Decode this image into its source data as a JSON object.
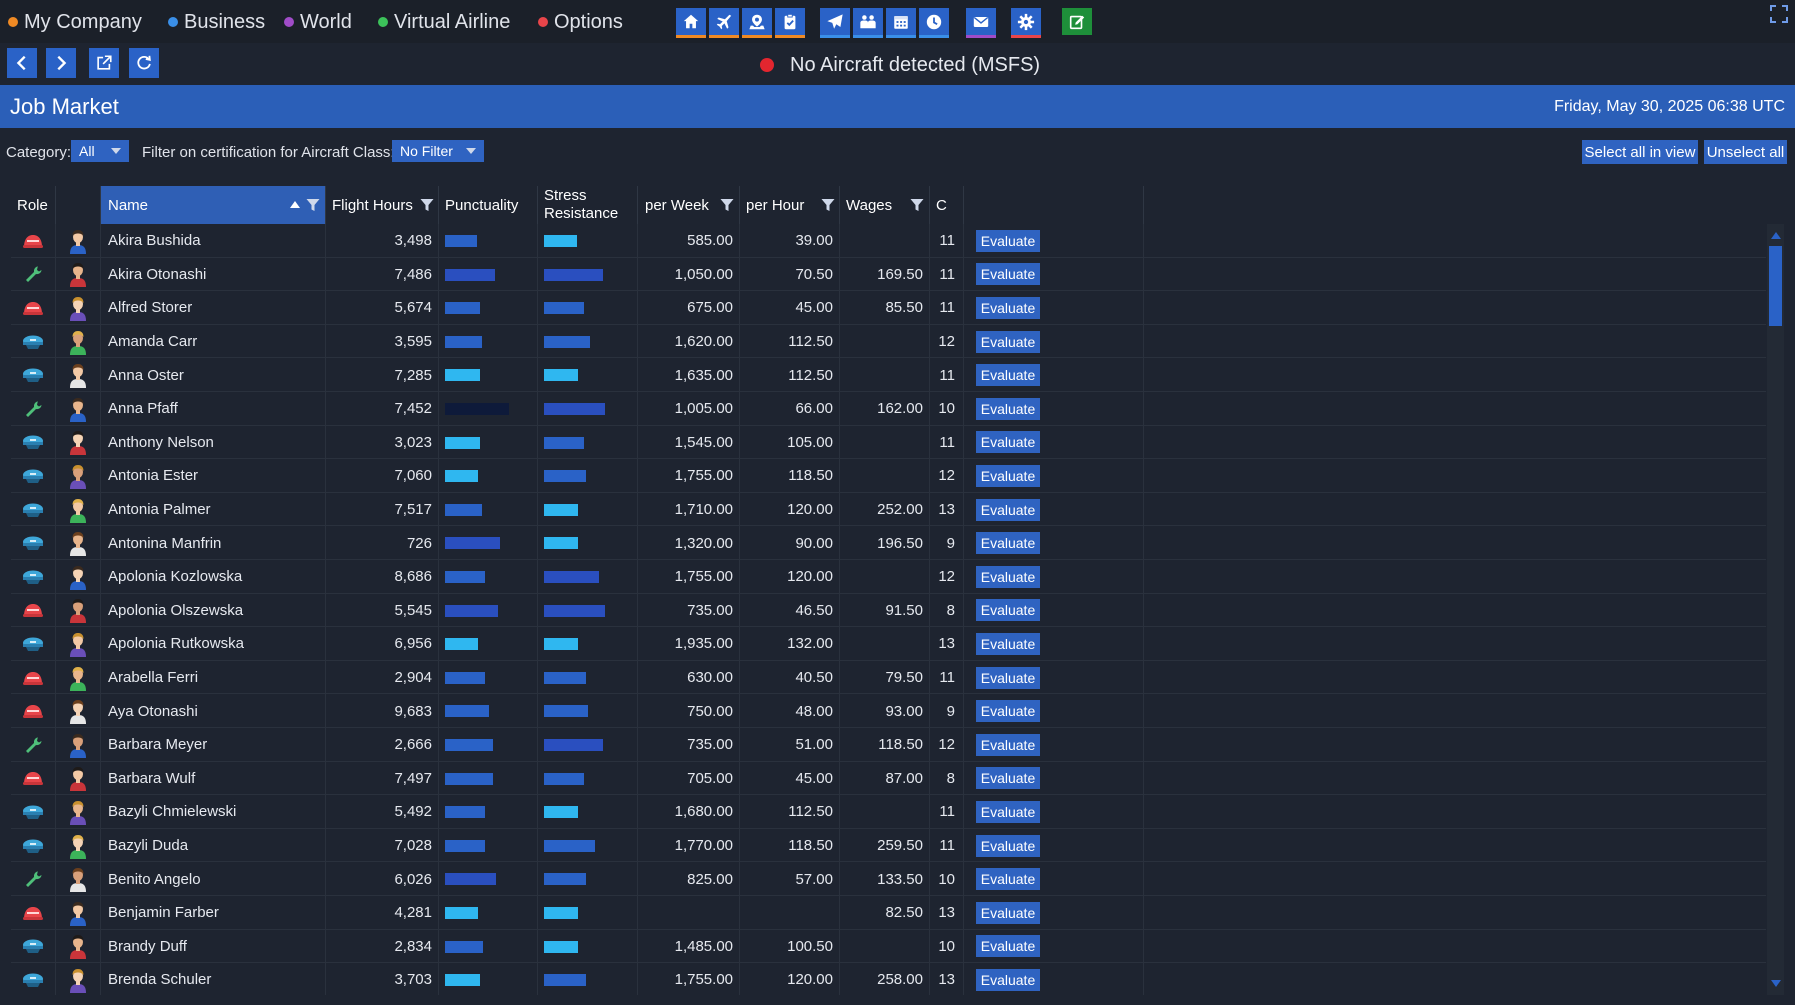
{
  "menu": {
    "items": [
      {
        "label": "My Company",
        "color": "#f08a24"
      },
      {
        "label": "Business",
        "color": "#3a8fe8"
      },
      {
        "label": "World",
        "color": "#a04cc8"
      },
      {
        "label": "Virtual Airline",
        "color": "#3cc25a"
      },
      {
        "label": "Options",
        "color": "#e8454a"
      }
    ]
  },
  "toolbar_icons": [
    "home-icon",
    "plane-icon",
    "map-pin-icon",
    "clipboard-icon",
    "paper-plane-icon",
    "people-icon",
    "calendar-icon",
    "clock-icon",
    "mail-icon",
    "gear-icon",
    "edit-icon"
  ],
  "status": {
    "text": "No Aircraft detected (MSFS)",
    "color": "#e3262f"
  },
  "page": {
    "title": "Job Market",
    "datetime": "Friday, May 30, 2025 06:38 UTC"
  },
  "filters": {
    "category_label": "Category:",
    "category_value": "All",
    "cert_label": "Filter on certification for Aircraft Class:",
    "cert_value": "No Filter",
    "select_all": "Select all in view",
    "unselect_all": "Unselect all"
  },
  "table": {
    "headers": {
      "role": "Role",
      "name": "Name",
      "flight_hours": "Flight Hours",
      "punctuality": "Punctuality",
      "stress": "Stress Resistance",
      "per_week": "per Week",
      "per_hour": "per Hour",
      "wages": "Wages",
      "c": "C"
    },
    "button_label": "Evaluate",
    "rows": [
      {
        "role": "attendant",
        "name": "Akira Bushida",
        "hours": "3,498",
        "punct": 0.35,
        "pc": "#2a62c7",
        "stress": 0.35,
        "sc": "#2fb7f0",
        "week": "585.00",
        "hour": "39.00",
        "wages": "",
        "c": "11"
      },
      {
        "role": "mechanic",
        "name": "Akira Otonashi",
        "hours": "7,486",
        "punct": 0.55,
        "pc": "#2a4fbf",
        "stress": 0.62,
        "sc": "#2a4fbf",
        "week": "1,050.00",
        "hour": "70.50",
        "wages": "169.50",
        "c": "11"
      },
      {
        "role": "attendant",
        "name": "Alfred Storer",
        "hours": "5,674",
        "punct": 0.38,
        "pc": "#2a62c7",
        "stress": 0.42,
        "sc": "#2a62c7",
        "week": "675.00",
        "hour": "45.00",
        "wages": "85.50",
        "c": "11"
      },
      {
        "role": "pilot",
        "name": "Amanda Carr",
        "hours": "3,595",
        "punct": 0.4,
        "pc": "#2a62c7",
        "stress": 0.48,
        "sc": "#2a62c7",
        "week": "1,620.00",
        "hour": "112.50",
        "wages": "",
        "c": "12"
      },
      {
        "role": "pilot",
        "name": "Anna Oster",
        "hours": "7,285",
        "punct": 0.38,
        "pc": "#2fb7f0",
        "stress": 0.36,
        "sc": "#2fb7f0",
        "week": "1,635.00",
        "hour": "112.50",
        "wages": "",
        "c": "11"
      },
      {
        "role": "mechanic",
        "name": "Anna Pfaff",
        "hours": "7,452",
        "punct": 0.7,
        "pc": "#0e1a3a",
        "stress": 0.64,
        "sc": "#2a4fbf",
        "week": "1,005.00",
        "hour": "66.00",
        "wages": "162.00",
        "c": "10"
      },
      {
        "role": "pilot",
        "name": "Anthony Nelson",
        "hours": "3,023",
        "punct": 0.38,
        "pc": "#2fb7f0",
        "stress": 0.42,
        "sc": "#2a62c7",
        "week": "1,545.00",
        "hour": "105.00",
        "wages": "",
        "c": "11"
      },
      {
        "role": "pilot",
        "name": "Antonia Ester",
        "hours": "7,060",
        "punct": 0.36,
        "pc": "#2fb7f0",
        "stress": 0.44,
        "sc": "#2a62c7",
        "week": "1,755.00",
        "hour": "118.50",
        "wages": "",
        "c": "12"
      },
      {
        "role": "pilot",
        "name": "Antonia Palmer",
        "hours": "7,517",
        "punct": 0.4,
        "pc": "#2a62c7",
        "stress": 0.36,
        "sc": "#2fb7f0",
        "week": "1,710.00",
        "hour": "120.00",
        "wages": "252.00",
        "c": "13"
      },
      {
        "role": "pilot",
        "name": "Antonina Manfrin",
        "hours": "726",
        "punct": 0.6,
        "pc": "#2a4fbf",
        "stress": 0.36,
        "sc": "#2fb7f0",
        "week": "1,320.00",
        "hour": "90.00",
        "wages": "196.50",
        "c": "9"
      },
      {
        "role": "pilot",
        "name": "Apolonia Kozlowska",
        "hours": "8,686",
        "punct": 0.44,
        "pc": "#2a62c7",
        "stress": 0.58,
        "sc": "#2a4fbf",
        "week": "1,755.00",
        "hour": "120.00",
        "wages": "",
        "c": "12"
      },
      {
        "role": "attendant",
        "name": "Apolonia Olszewska",
        "hours": "5,545",
        "punct": 0.58,
        "pc": "#2a4fbf",
        "stress": 0.64,
        "sc": "#2a4fbf",
        "week": "735.00",
        "hour": "46.50",
        "wages": "91.50",
        "c": "8"
      },
      {
        "role": "pilot",
        "name": "Apolonia Rutkowska",
        "hours": "6,956",
        "punct": 0.36,
        "pc": "#2fb7f0",
        "stress": 0.36,
        "sc": "#2fb7f0",
        "week": "1,935.00",
        "hour": "132.00",
        "wages": "",
        "c": "13"
      },
      {
        "role": "attendant",
        "name": "Arabella Ferri",
        "hours": "2,904",
        "punct": 0.44,
        "pc": "#2a62c7",
        "stress": 0.44,
        "sc": "#2a62c7",
        "week": "630.00",
        "hour": "40.50",
        "wages": "79.50",
        "c": "11"
      },
      {
        "role": "attendant",
        "name": "Aya Otonashi",
        "hours": "9,683",
        "punct": 0.48,
        "pc": "#2a62c7",
        "stress": 0.46,
        "sc": "#2a62c7",
        "week": "750.00",
        "hour": "48.00",
        "wages": "93.00",
        "c": "9"
      },
      {
        "role": "mechanic",
        "name": "Barbara Meyer",
        "hours": "2,666",
        "punct": 0.52,
        "pc": "#2a62c7",
        "stress": 0.62,
        "sc": "#2a4fbf",
        "week": "735.00",
        "hour": "51.00",
        "wages": "118.50",
        "c": "12"
      },
      {
        "role": "attendant",
        "name": "Barbara Wulf",
        "hours": "7,497",
        "punct": 0.52,
        "pc": "#2a62c7",
        "stress": 0.42,
        "sc": "#2a62c7",
        "week": "705.00",
        "hour": "45.00",
        "wages": "87.00",
        "c": "8"
      },
      {
        "role": "pilot",
        "name": "Bazyli Chmielewski",
        "hours": "5,492",
        "punct": 0.44,
        "pc": "#2a62c7",
        "stress": 0.36,
        "sc": "#2fb7f0",
        "week": "1,680.00",
        "hour": "112.50",
        "wages": "",
        "c": "11"
      },
      {
        "role": "pilot",
        "name": "Bazyli Duda",
        "hours": "7,028",
        "punct": 0.44,
        "pc": "#2a62c7",
        "stress": 0.54,
        "sc": "#2a62c7",
        "week": "1,770.00",
        "hour": "118.50",
        "wages": "259.50",
        "c": "11"
      },
      {
        "role": "mechanic",
        "name": "Benito Angelo",
        "hours": "6,026",
        "punct": 0.56,
        "pc": "#2a4fbf",
        "stress": 0.44,
        "sc": "#2a62c7",
        "week": "825.00",
        "hour": "57.00",
        "wages": "133.50",
        "c": "10"
      },
      {
        "role": "attendant",
        "name": "Benjamin Farber",
        "hours": "4,281",
        "punct": 0.36,
        "pc": "#2fb7f0",
        "stress": 0.36,
        "sc": "#2fb7f0",
        "week": "",
        "hour": "",
        "wages": "82.50",
        "c": "13"
      },
      {
        "role": "pilot",
        "name": "Brandy Duff",
        "hours": "2,834",
        "punct": 0.42,
        "pc": "#2a62c7",
        "stress": 0.36,
        "sc": "#2fb7f0",
        "week": "1,485.00",
        "hour": "100.50",
        "wages": "",
        "c": "10"
      },
      {
        "role": "pilot",
        "name": "Brenda Schuler",
        "hours": "3,703",
        "punct": 0.38,
        "pc": "#2fb7f0",
        "stress": 0.44,
        "sc": "#2a62c7",
        "week": "1,755.00",
        "hour": "120.00",
        "wages": "258.00",
        "c": "13"
      }
    ]
  }
}
